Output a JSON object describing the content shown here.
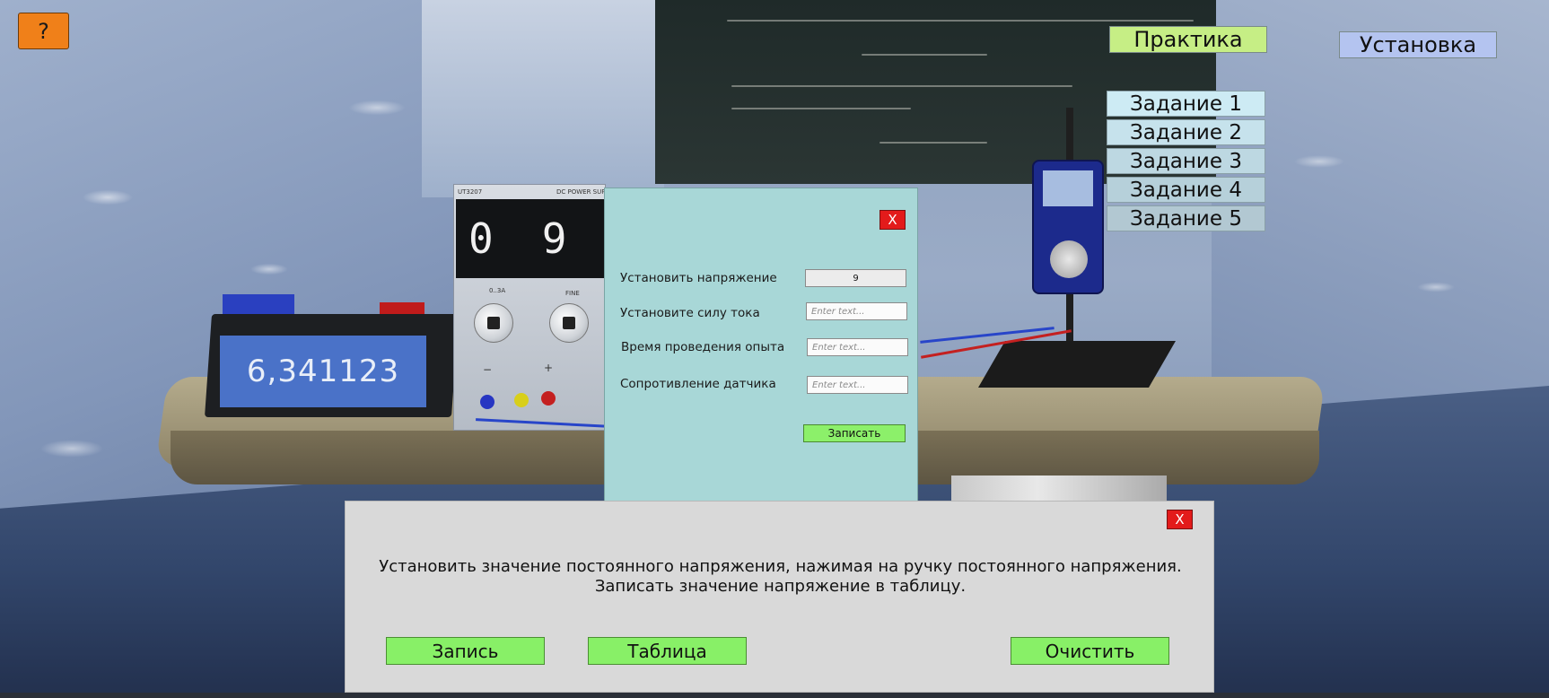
{
  "scene": {
    "reading_display": "6,341123",
    "psu_digits": [
      "0",
      "9"
    ],
    "psu_brand": "UT3207",
    "psu_model_label": "DC POWER SUPPLY",
    "psu_coarse_label": "0..3A",
    "psu_fine_label": "FINE",
    "psu_terminal_minus": "−",
    "psu_terminal_plus": "+"
  },
  "header": {
    "help_label": "?",
    "practice_label": "Практика",
    "setup_label": "Установка"
  },
  "tasks": [
    {
      "label": "Задание 1"
    },
    {
      "label": "Задание 2"
    },
    {
      "label": "Задание 3"
    },
    {
      "label": "Задание 4"
    },
    {
      "label": "Задание 5"
    }
  ],
  "dialog": {
    "close_label": "X",
    "fields": [
      {
        "label": "Установить напряжение",
        "value": "9",
        "placeholder": ""
      },
      {
        "label": "Установите силу тока",
        "value": "",
        "placeholder": "Enter text..."
      },
      {
        "label": "Время проведения опыта",
        "value": "",
        "placeholder": "Enter text..."
      },
      {
        "label": "Сопротивление датчика",
        "value": "",
        "placeholder": "Enter text..."
      }
    ],
    "save_label": "Записать"
  },
  "panel": {
    "close_label": "X",
    "instruction": "Установить значение постоянного напряжения, нажимая на ручку постоянного напряжения. Записать значение напряжение в таблицу.",
    "record_label": "Запись",
    "table_label": "Таблица",
    "clear_label": "Очистить"
  },
  "colors": {
    "help": "#f08019",
    "practice": "#c6ee85",
    "setup": "#b4c4f0",
    "dialog_bg": "#a8d7d7",
    "close": "#e31b1b",
    "green_button": "#88f067",
    "panel_bg": "#d9d9d9"
  }
}
